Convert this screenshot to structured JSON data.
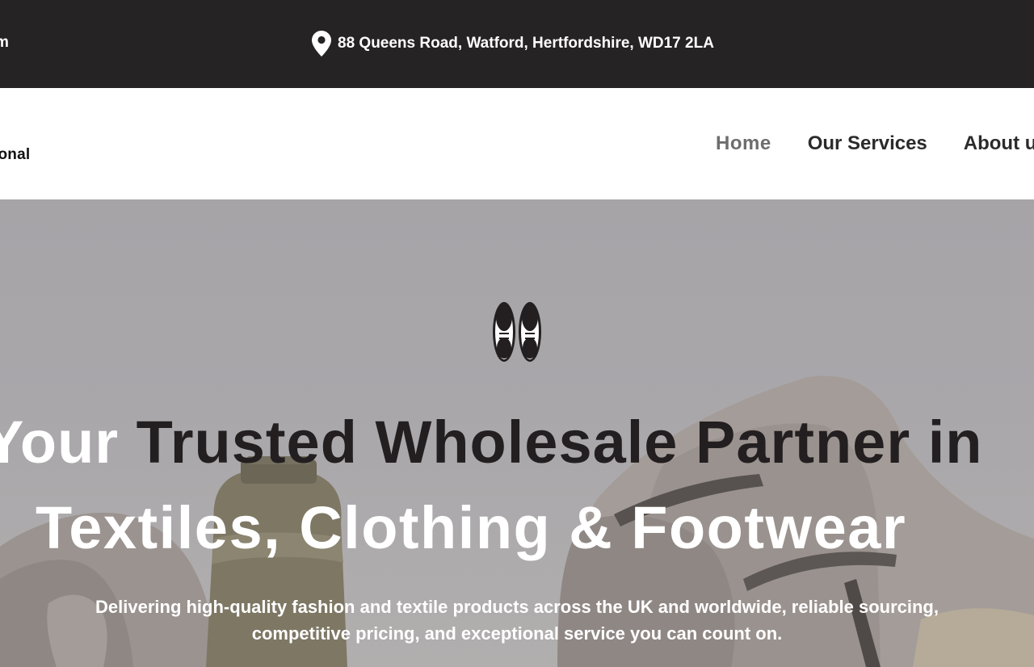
{
  "topbar": {
    "contact_partial": "m",
    "address": "88 Queens Road, Watford, Hertfordshire, WD17 2LA",
    "address_icon": "location-pin-icon"
  },
  "header": {
    "logo_partial": "ional",
    "nav": [
      {
        "label": "Home",
        "active": true
      },
      {
        "label": "Our Services",
        "active": false
      },
      {
        "label": "About u",
        "active": false
      }
    ]
  },
  "hero": {
    "icon": "shoes-icon",
    "title_line1_prefix": "Your ",
    "title_line1_rest": "Trusted Wholesale Partner in",
    "title_line2": "Textiles, Clothing & Footwear",
    "subtitle_line1": "Delivering high-quality fashion and textile products across the UK and worldwide, reliable sourcing,",
    "subtitle_line2": "competitive pricing, and exceptional service you can count on."
  },
  "colors": {
    "topbar_bg": "#262324",
    "nav_text": "#2b2b2b",
    "nav_active": "#6d6d6d",
    "hero_dark_text": "#231f20"
  }
}
